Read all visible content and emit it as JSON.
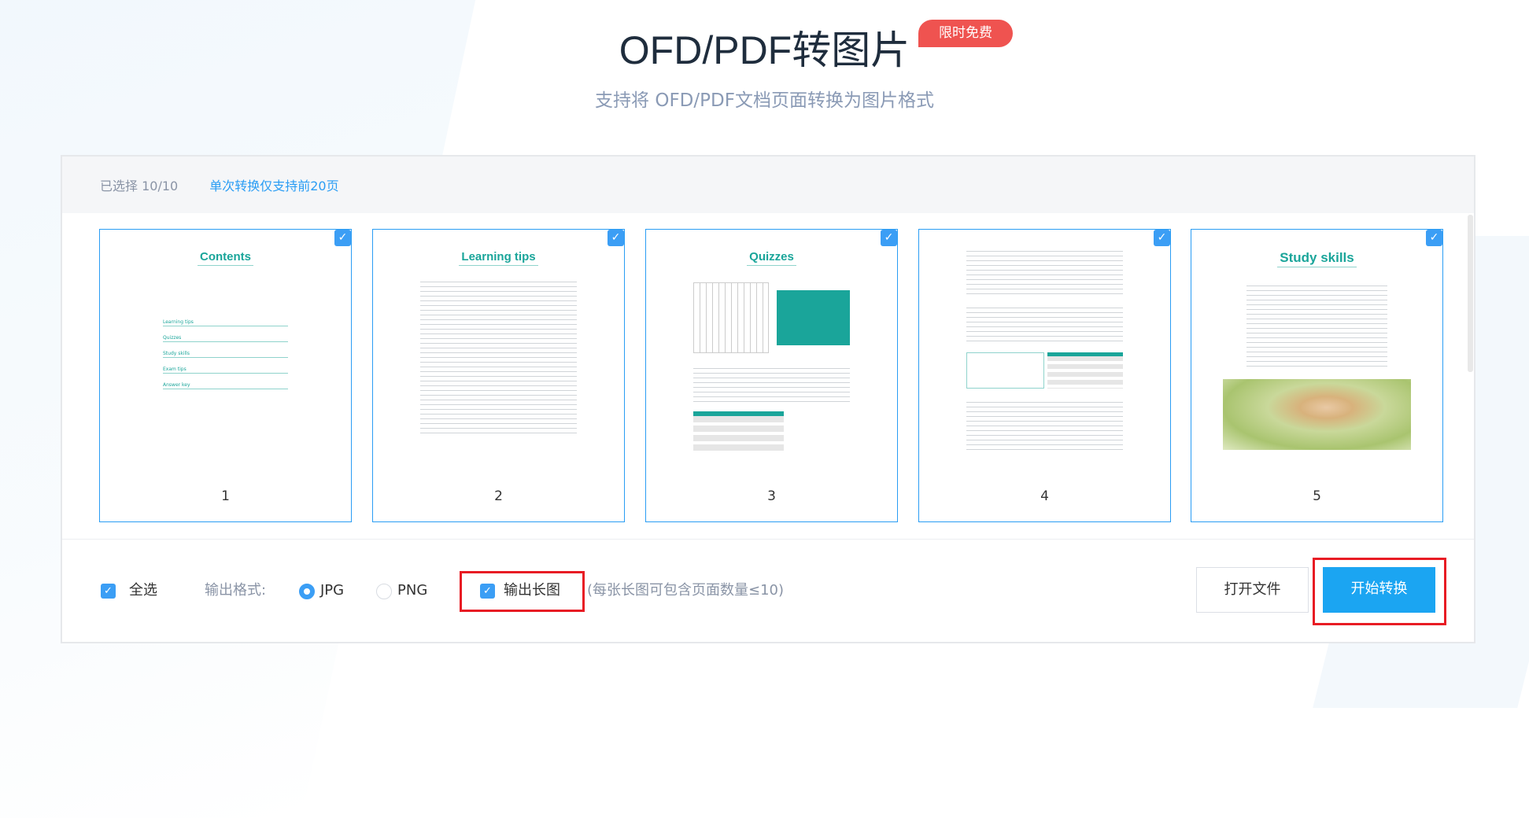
{
  "header": {
    "title": "OFD/PDF转图片",
    "badge": "限时免费",
    "subtitle": "支持将  OFD/PDF文档页面转换为图片格式"
  },
  "panel": {
    "selected": "已选择 10/10",
    "limit_tip": "单次转换仅支持前20页"
  },
  "pages": [
    {
      "number": "1",
      "title": "Contents",
      "checked": true,
      "toc": [
        "Learning tips",
        "Quizzes",
        "Study skills",
        "Exam tips",
        "Answer key"
      ]
    },
    {
      "number": "2",
      "title": "Learning tips",
      "checked": true
    },
    {
      "number": "3",
      "title": "Quizzes",
      "checked": true
    },
    {
      "number": "4",
      "title": "",
      "checked": true
    },
    {
      "number": "5",
      "title": "Study skills",
      "checked": true
    }
  ],
  "footer": {
    "select_all": "全选",
    "format_label": "输出格式:",
    "formats": [
      "JPG",
      "PNG"
    ],
    "selected_format": "JPG",
    "long_image": "输出长图",
    "long_image_hint": "(每张长图可包含页面数量≤10)",
    "open_file": "打开文件",
    "start": "开始转换"
  },
  "colors": {
    "accent": "#2a9df4",
    "badge": "#ef5350",
    "highlight": "#e81c24",
    "teal": "#1aa59a"
  }
}
